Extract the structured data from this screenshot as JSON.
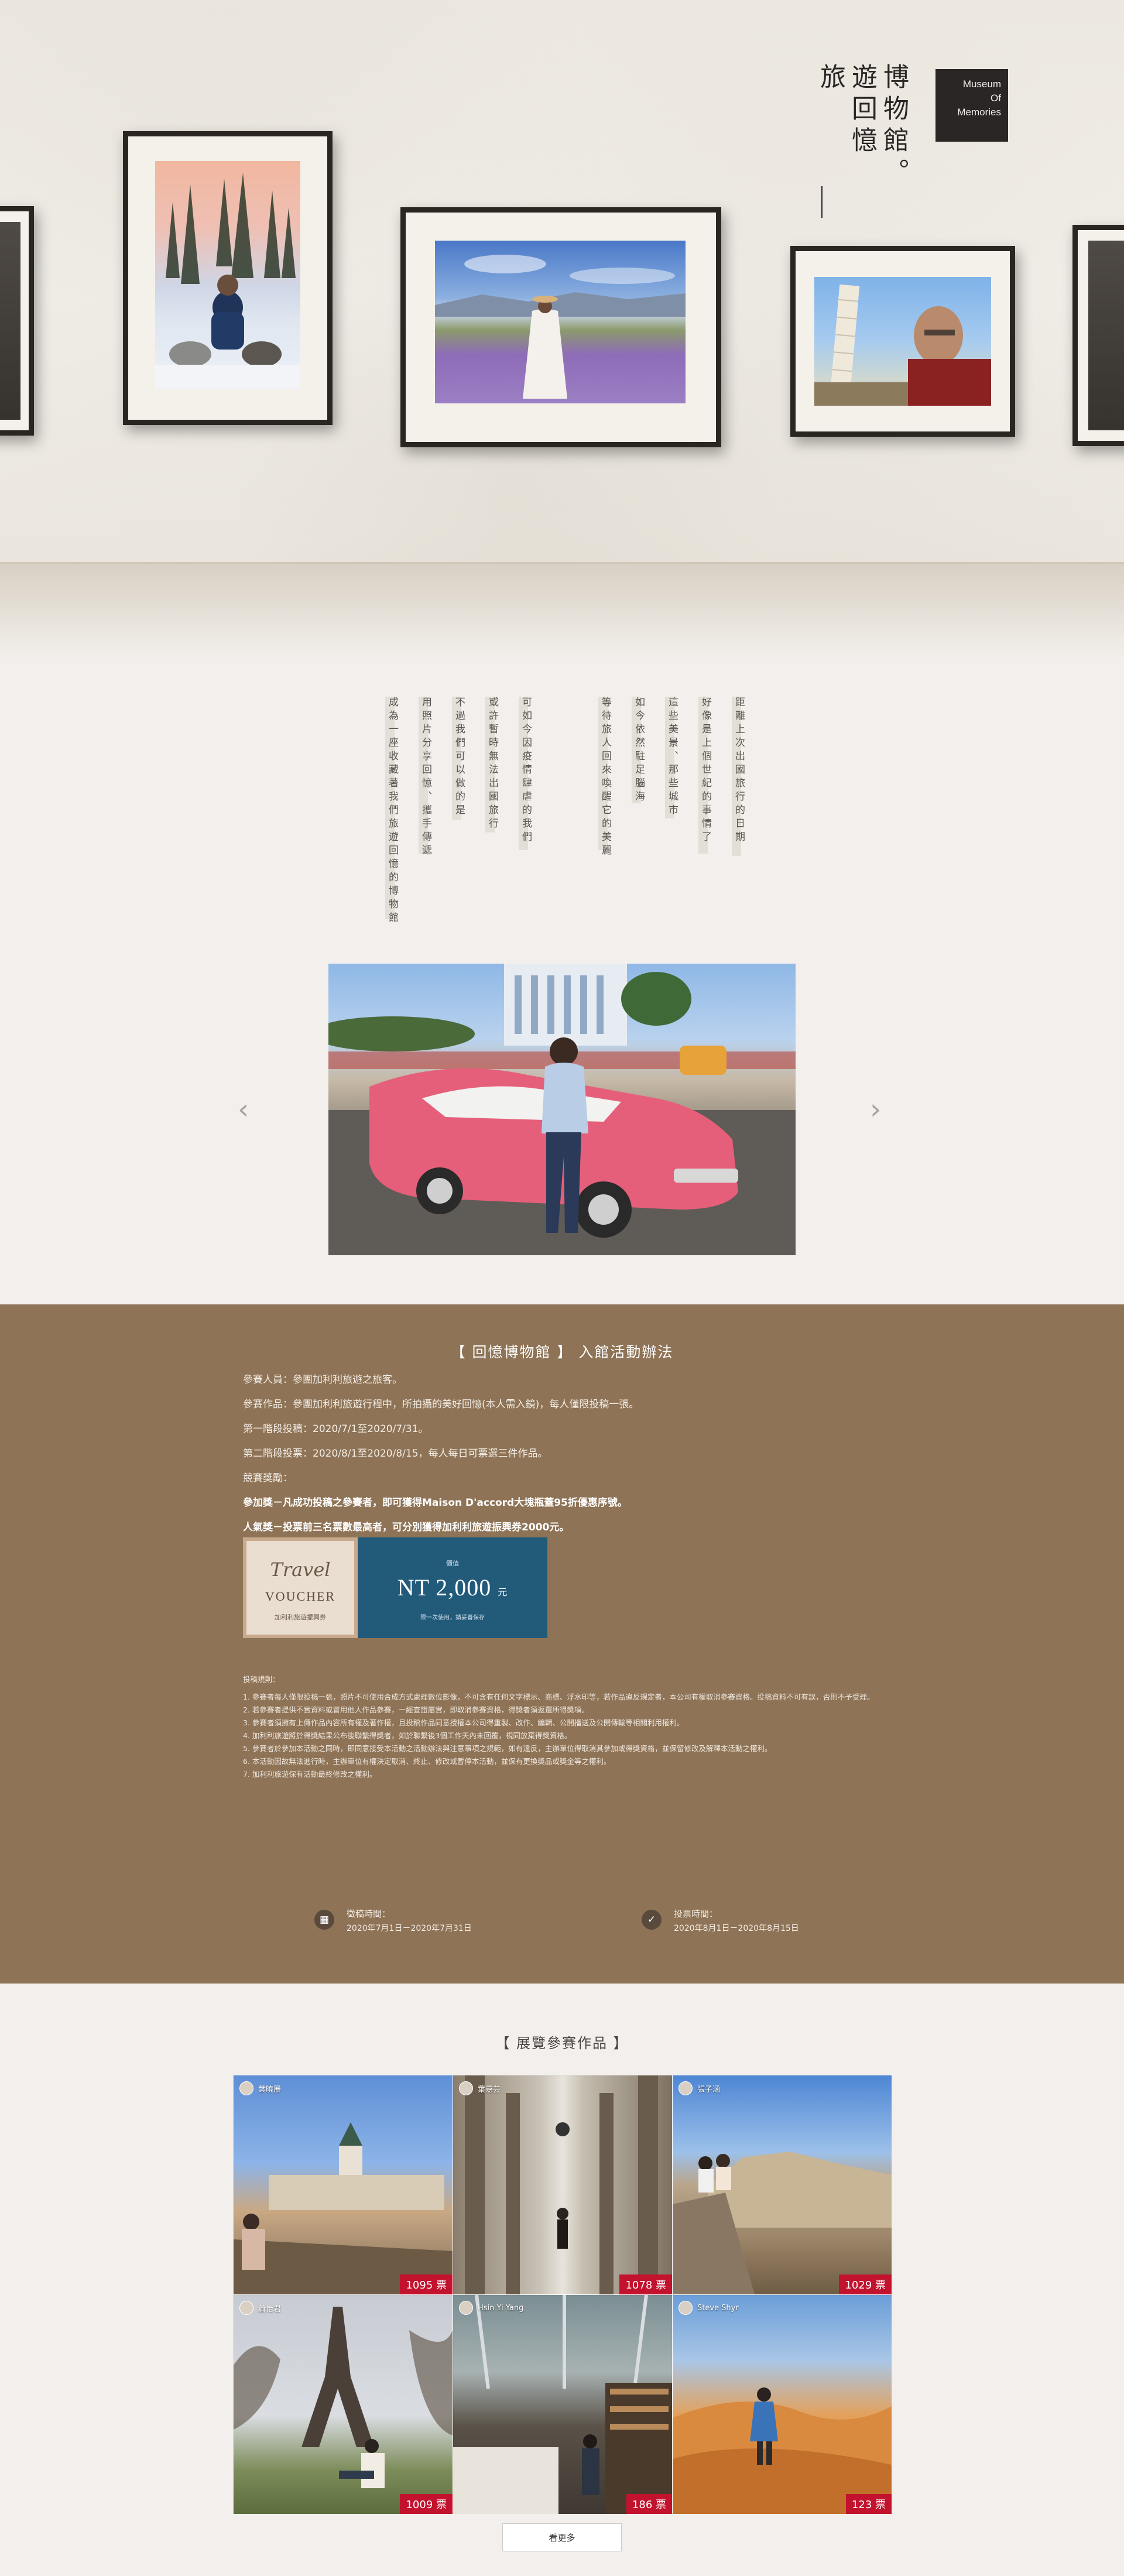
{
  "hero": {
    "title_cols": [
      "博物館。",
      "遊回憶",
      "旅"
    ],
    "logo_lines": [
      "Museum",
      "Of",
      "Memories"
    ]
  },
  "poem": {
    "columns": [
      "距離上次出國旅行的日期",
      "好像是上個世紀的事情了",
      "這些美景、那些城市",
      "如今依然駐足腦海",
      "等待旅人回來喚醒它的美麗",
      "可如今因疫情肆虐的我們",
      "或許暫時無法出國旅行",
      "不過我們可以做的是",
      "用照片分享回憶、攜手傳遞",
      "成為一座收藏著我們旅遊回憶的博物館"
    ]
  },
  "carousel": {
    "prev": "‹",
    "next": "›"
  },
  "rules": {
    "title": "【 回憶博物館 】 入館活動辦法",
    "lines": [
      "參賽人員：參團加利利旅遊之旅客。",
      "參賽作品：參團加利利旅遊行程中，所拍攝的美好回憶(本人需入鏡)，每人僅限投稿一張。",
      "第一階段投稿：2020/7/1至2020/7/31。",
      "第二階段投票：2020/8/1至2020/8/15，每人每日可票選三件作品。",
      "競賽獎勵："
    ],
    "bold_lines": [
      "參加獎－凡成功投稿之參賽者，即可獲得Maison D'accord大塊瓶蓋95折優惠序號。",
      "人氣獎－投票前三名票數最高者，可分別獲得加利利旅遊振興券2000元。"
    ],
    "voucher": {
      "script": "Travel",
      "word": "VOUCHER",
      "sub": "加利利旅遊振興券",
      "top": "價值",
      "amount": "NT 2,000",
      "unit": "元",
      "foot": "限一次使用，請妥善保存"
    },
    "notes_title": "投稿規則：",
    "notes": [
      "1. 參賽者每人僅限投稿一張，照片不可使用合成方式處理數位影像，不可含有任何文字標示、商標、浮水印等，若作品違反規定者，本公司有權取消參賽資格。投稿資料不可有誤，否則不予受理。",
      "2. 若參賽者提供不實資料或冒用他人作品參賽，一經查證屬實，即取消參賽資格，得獎者須返還所得獎項。",
      "3. 參賽者須擁有上傳作品內容所有權及著作權，且投稿作品同意授權本公司得重製、改作、編輯、公開播送及公開傳輸等相關利用權利。",
      "4. 加利利旅遊將於得獎結果公布後聯繫得獎者，如於聯繫後3個工作天內未回覆，視同放棄得獎資格。",
      "5. 參賽者於參加本活動之同時，即同意接受本活動之活動辦法與注意事項之規範，如有違反，主辦單位得取消其參加或得獎資格，並保留修改及解釋本活動之權利。",
      "6. 本活動因故無法進行時，主辦單位有權決定取消、終止、修改或暫停本活動，並保有更換獎品或獎金等之權利。",
      "7. 加利利旅遊保有活動最終修改之權利。"
    ],
    "dates": [
      {
        "icon": "calendar-icon",
        "glyph": "▦",
        "label": "徵稿時間：",
        "value": "2020年7月1日－2020年7月31日"
      },
      {
        "icon": "thumbs-up-icon",
        "glyph": "✓",
        "label": "投票時間：",
        "value": "2020年8月1日－2020年8月15日"
      }
    ]
  },
  "entries": {
    "title": "【 展覽參賽作品 】",
    "items": [
      {
        "name": "葉曉展",
        "votes": "1095 票"
      },
      {
        "name": "葉嘉芸",
        "votes": "1078 票"
      },
      {
        "name": "張子涵",
        "votes": "1029 票"
      },
      {
        "name": "蕭怡君",
        "votes": "1009 票"
      },
      {
        "name": "Hsin Yi Yang",
        "votes": "186 票"
      },
      {
        "name": "Steve Shyr",
        "votes": "123 票"
      }
    ],
    "more": "看更多"
  }
}
